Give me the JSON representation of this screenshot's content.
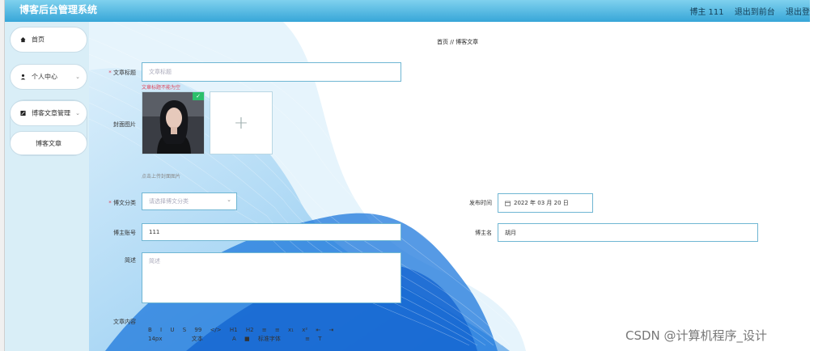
{
  "header": {
    "brand": "博客后台管理系统",
    "user": "博主 111",
    "to_front": "退出到前台",
    "logout": "退出登"
  },
  "sidebar": {
    "home": "首页",
    "personal": "个人中心",
    "blog_mgmt": "博客文章管理",
    "blog_article": "博客文章"
  },
  "breadcrumb": "首页  //  博客文章",
  "form": {
    "title_label": "文章标题",
    "title_placeholder": "文章标题",
    "title_error": "文章标题不能为空",
    "cover_label": "封面图片",
    "upload_plus": "+",
    "upload_hint": "点击上传封面图片",
    "category_label": "博文分类",
    "category_placeholder": "请选择博文分类",
    "publish_label": "发布时间",
    "publish_value": "2022 年 03 月 20 日",
    "account_label": "博主账号",
    "account_value": "111",
    "name_label": "博主名",
    "name_value": "胡月",
    "summary_label": "简述",
    "summary_placeholder": "简述",
    "content_label": "文章内容"
  },
  "toolbar": {
    "row1": [
      "B",
      "I",
      "U",
      "S",
      "99",
      "</>",
      "H1",
      "H2",
      "≡",
      "≡",
      "x₁",
      "x²",
      "⇤",
      "⇥"
    ],
    "font_size": "14px",
    "text_style": "文本",
    "font_family": "标准字体"
  },
  "watermark": "CSDN @计算机程序_设计"
}
